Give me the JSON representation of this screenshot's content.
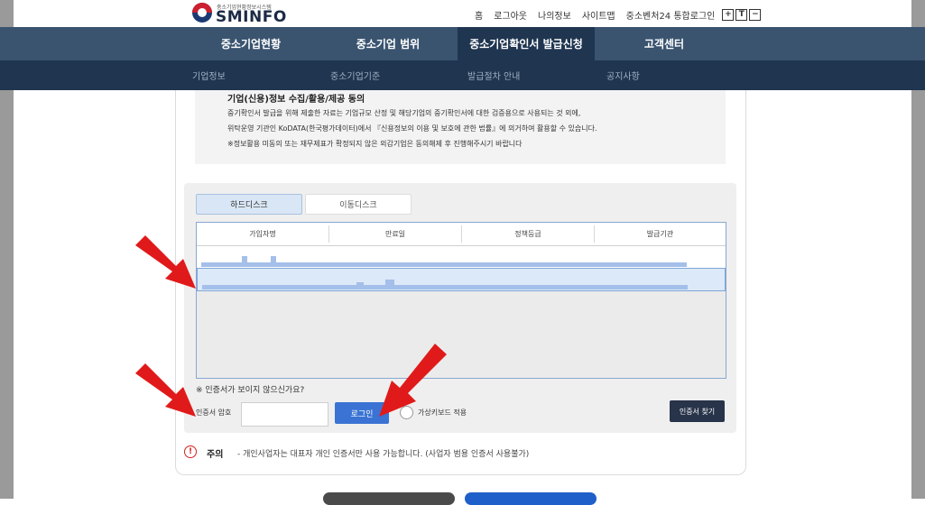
{
  "header": {
    "logo_tagline": "중소기업현황정보시스템",
    "logo_name": "SMINFO",
    "utility_links": [
      "홈",
      "로그아웃",
      "나의정보",
      "사이트맵",
      "중소벤처24 통합로그인"
    ],
    "font_size_buttons": [
      "+",
      "T",
      "−"
    ]
  },
  "nav": {
    "primary": [
      "중소기업현황",
      "중소기업 범위",
      "중소기업확인서 발급신청",
      "고객센터"
    ],
    "active_index": 2,
    "secondary": [
      "기업정보",
      "중소기업기준",
      "발급절차 안내",
      "공지사항"
    ]
  },
  "consent": {
    "title": "기업(신용)정보 수집/활용/제공 동의",
    "lines": [
      "중기확인서 발급을 위해 제출한 자료는 기업규모 산정 및 해당기업의 중기확인서에 대한 검증용으로 사용되는 것 외에,",
      "위탁운영 기관인 KoDATA(한국평가데이터)에서 『신용정보의 이용 및 보호에 관한 법률』에 의거하여 활용할 수 있습니다.",
      "※정보활용 미동의 또는 재무제표가 확정되지 않은 외감기업은 동의해제 후 진행해주시기 바랍니다"
    ]
  },
  "cert": {
    "tabs": [
      "하드디스크",
      "이동디스크"
    ],
    "active_tab": 0,
    "columns": [
      "가입자명",
      "만료일",
      "정책등급",
      "발급기관"
    ],
    "hint": "※ 인증서가 보이지 않으신가요?",
    "password_label": "인증서 암호",
    "password_value": "",
    "login_label": "로그인",
    "virtual_keyboard_label": "가상키보드 적용",
    "find_label": "인증서 찾기"
  },
  "notice": {
    "icon_text": "!",
    "title": "주의",
    "text": "- 개인사업자는 대표자 개인 인증서만 사용 가능합니다. (사업자 범용 인증서 사용불가)"
  },
  "colors": {
    "nav_primary": "#3a5470",
    "nav_secondary": "#1f3550",
    "accent_blue": "#3a73d3",
    "arrow_red": "#e01a1a"
  }
}
